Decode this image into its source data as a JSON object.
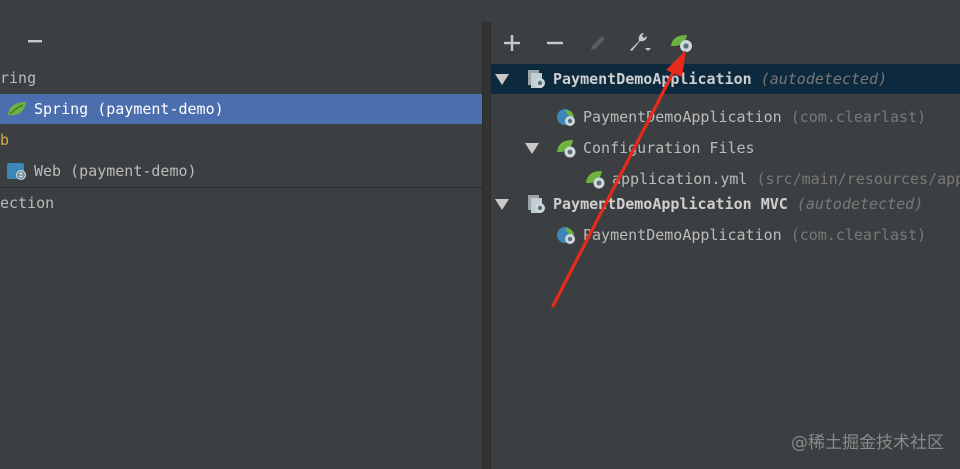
{
  "left_panel": {
    "toolbar": {
      "remove_icon": "minus-icon"
    },
    "items": [
      {
        "label": "ring",
        "icon": "none"
      },
      {
        "label": "Spring (payment-demo)",
        "icon": "spring-leaf-icon",
        "selected": true
      },
      {
        "label": "b",
        "icon": "none"
      },
      {
        "label": "Web (payment-demo)",
        "icon": "web-module-icon"
      },
      {
        "label": "ection",
        "icon": "none"
      }
    ]
  },
  "right_panel": {
    "toolbar": [
      "add-icon",
      "remove-icon",
      "edit-icon",
      "wrench-icon",
      "spring-config-icon"
    ],
    "tree": {
      "ctx1": {
        "label": "PaymentDemoApplication",
        "suffix": "(autodetected)"
      },
      "ctx1_class": {
        "label": "PaymentDemoApplication",
        "pkg": "(com.clearlast)"
      },
      "config_files": {
        "label": "Configuration Files"
      },
      "yml": {
        "label": "application.yml",
        "path": "(src/main/resources/app"
      },
      "ctx2": {
        "label": "PaymentDemoApplication MVC",
        "suffix": "(autodetected)"
      },
      "ctx2_class": {
        "label": "PaymentDemoApplication",
        "pkg": "(com.clearlast)"
      }
    }
  },
  "annotation": {
    "arrow_color": "#e8291c"
  },
  "watermark": "@稀土掘金技术社区"
}
